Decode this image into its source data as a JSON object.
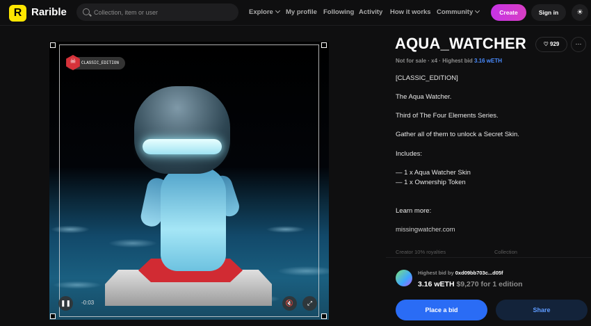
{
  "header": {
    "logo_mark": "R",
    "logo_text": "Rarible",
    "search_placeholder": "Collection, item or user",
    "nav": [
      {
        "label": "Explore"
      },
      {
        "label": "My profile"
      },
      {
        "label": "Following"
      },
      {
        "label": "Activity"
      },
      {
        "label": "How it works"
      },
      {
        "label": "Community"
      }
    ],
    "create_label": "Create",
    "signin_label": "Sign in",
    "theme_icon": "sun-icon"
  },
  "media": {
    "edition_badge": "CLASSIC_EDITION",
    "time": "-0:03",
    "controls": [
      "pause-icon",
      "mute-icon",
      "fullscreen-icon"
    ]
  },
  "item": {
    "title": "AQUA_WATCHER",
    "likes": "929",
    "status": "Not for sale",
    "sep": "·",
    "count": "x4",
    "highest_bid_label": "Highest bid",
    "highest_bid": "3.16 wETH",
    "description": [
      "[CLASSIC_EDITION]",
      "The Aqua Watcher.",
      "Third of The Four Elements Series.",
      "Gather all of them to unlock a Secret Skin.",
      "Includes:",
      "— 1 x Aqua Watcher Skin",
      "— 1 x Ownership Token",
      "Learn more:",
      "missingwatcher.com"
    ],
    "creator_label": "Creator",
    "royalties": "10% royalties",
    "collection_label": "Collection"
  },
  "bid": {
    "label": "Highest bid by",
    "bidder": "0xd09bb703c...d05f",
    "amount": "3.16 wETH",
    "fiat": "$9,270 for 1 edition",
    "place_bid_label": "Place a bid",
    "share_label": "Share"
  }
}
